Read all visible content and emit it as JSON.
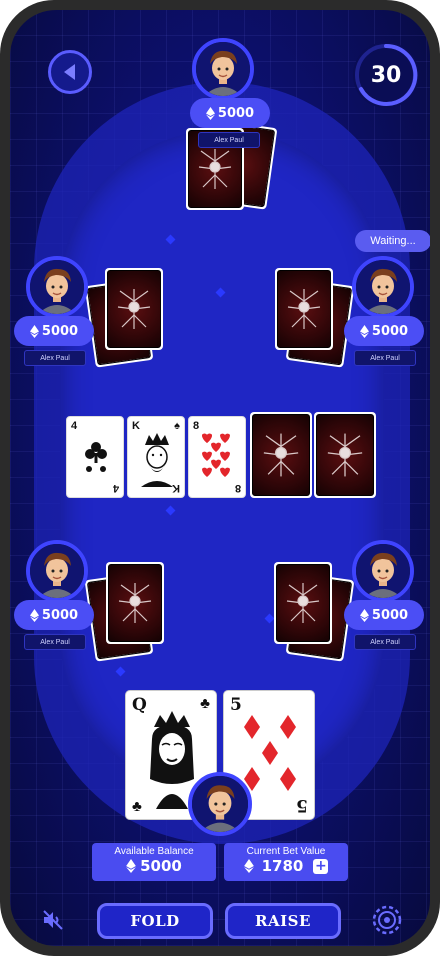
{
  "timer": {
    "seconds": "30"
  },
  "currency_icon": "ethereum-icon",
  "players": [
    {
      "id": "top",
      "balance": "5000",
      "name": "Alex Paul"
    },
    {
      "id": "mid-left",
      "balance": "5000",
      "name": "Alex Paul"
    },
    {
      "id": "mid-right",
      "balance": "5000",
      "name": "Alex Paul"
    },
    {
      "id": "low-left",
      "balance": "5000",
      "name": "Alex Paul"
    },
    {
      "id": "low-right",
      "balance": "5000",
      "name": "Alex Paul"
    }
  ],
  "status": {
    "waiting": "Waiting..."
  },
  "community_cards": [
    {
      "rank": "4",
      "suit": "♣",
      "color": "#111111"
    },
    {
      "rank": "K",
      "suit": "♠",
      "color": "#111111"
    },
    {
      "rank": "8",
      "suit": "♥",
      "color": "#e3262b"
    },
    {
      "face_down": true
    },
    {
      "face_down": true
    }
  ],
  "hand_cards": [
    {
      "rank": "Q",
      "suit": "♣",
      "color": "#111111"
    },
    {
      "rank": "5",
      "suit": "♦",
      "color": "#e3262b"
    }
  ],
  "info": {
    "available_label": "Available Balance",
    "available_value": "5000",
    "bet_label": "Current Bet Value",
    "bet_value": "1780"
  },
  "actions": {
    "fold": "FOLD",
    "raise": "RAISE"
  },
  "colors": {
    "accent": "#4a4cf0",
    "table": "#1f26c4",
    "background": "#0a0d55",
    "card_back": "#5a0e10"
  }
}
